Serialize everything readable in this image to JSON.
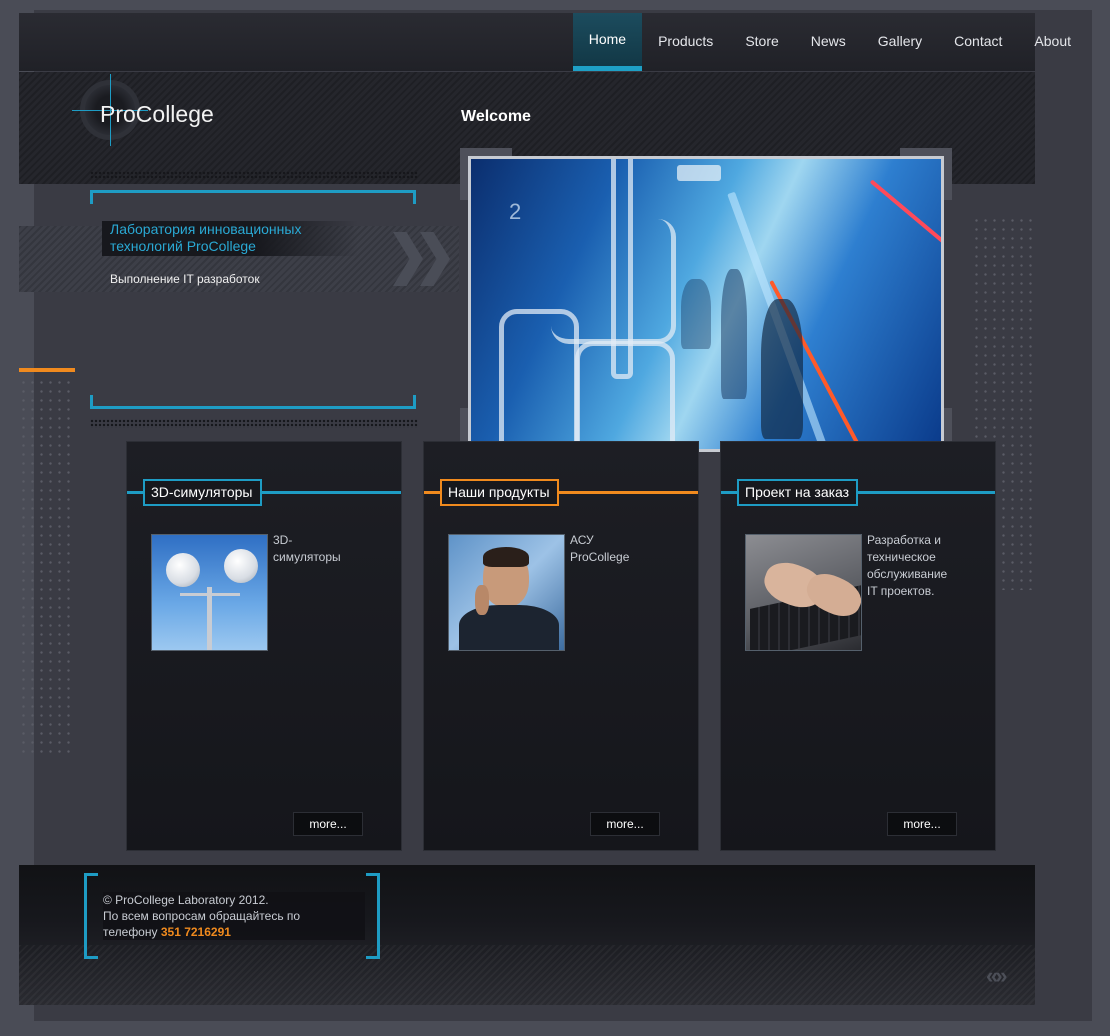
{
  "nav": {
    "items": [
      {
        "label": "Home"
      },
      {
        "label": "Products"
      },
      {
        "label": "Store"
      },
      {
        "label": "News"
      },
      {
        "label": "Gallery"
      },
      {
        "label": "Contact"
      },
      {
        "label": "About"
      }
    ],
    "active_index": 0
  },
  "logo": {
    "text": "ProCollege"
  },
  "welcome": "Welcome",
  "lab": {
    "title_line1": "Лаборатория инновационных",
    "title_line2": "технологий ProCollege",
    "subtitle": "Выполнение IT разработок"
  },
  "hero": {
    "digit": "2"
  },
  "cards": [
    {
      "title": "3D-симуляторы",
      "desc": "3D-\nсимуляторы",
      "more": "more..."
    },
    {
      "title": "Наши продукты",
      "desc": "АСУ\nProCollege",
      "more": "more..."
    },
    {
      "title": "Проект на заказ",
      "desc": "Разработка и\nтехническое\nобслуживание\nIT проектов.",
      "more": "more..."
    }
  ],
  "footer": {
    "line1": "© ProCollege Laboratory 2012.",
    "line2": "По всем вопросам обращайтесь по",
    "line3_prefix": "телефону",
    "phone": "351 7216291"
  },
  "pager": "«»",
  "colors": {
    "accent_blue": "#1e9cc4",
    "accent_orange": "#f08a1e",
    "page_bg": "#3a3b44"
  }
}
